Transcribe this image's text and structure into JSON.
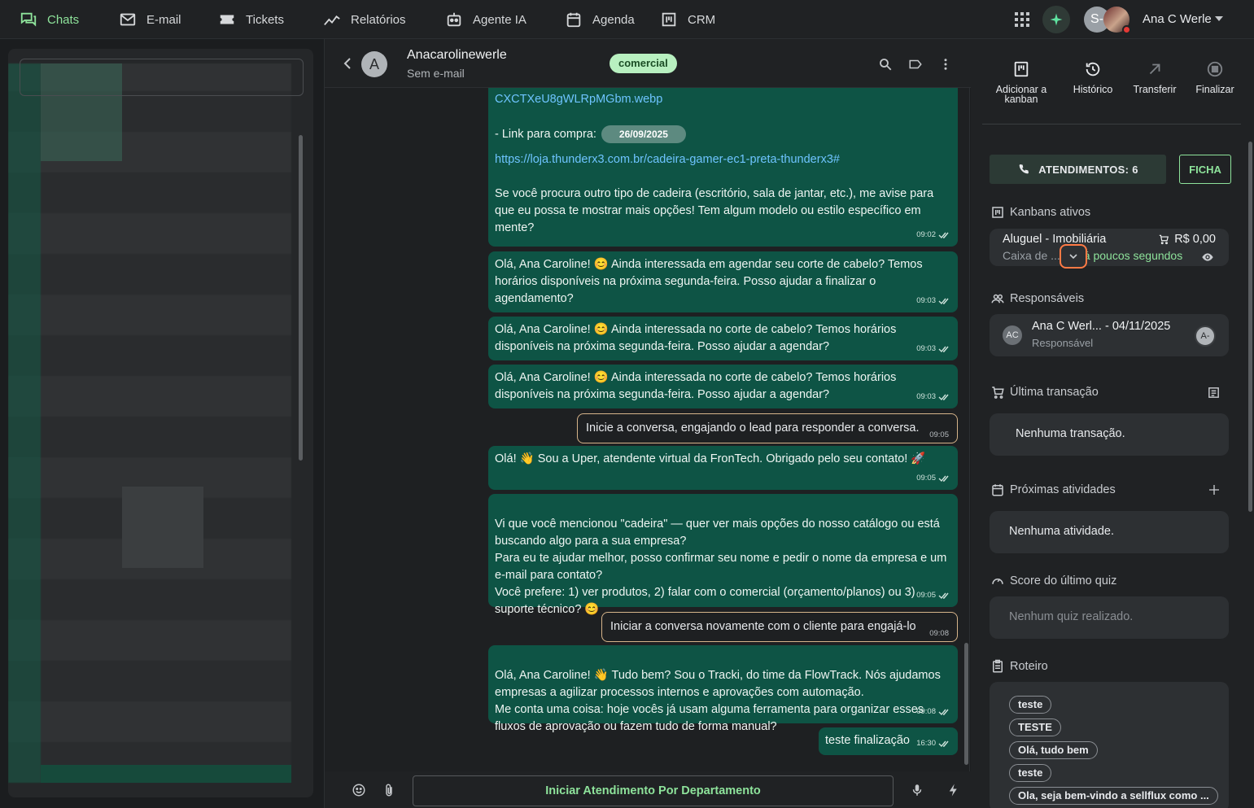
{
  "nav": {
    "items": [
      {
        "label": "Chats",
        "icon": "chat-icon",
        "active": true
      },
      {
        "label": "E-mail",
        "icon": "mail-icon"
      },
      {
        "label": "Tickets",
        "icon": "ticket-icon"
      },
      {
        "label": "Relatórios",
        "icon": "chart-line-icon"
      },
      {
        "label": "Agente IA",
        "icon": "robot-icon"
      },
      {
        "label": "Agenda",
        "icon": "calendar-icon"
      },
      {
        "label": "CRM",
        "icon": "kanban-icon"
      }
    ],
    "user_initial": "S-",
    "user_name": "Ana C Werle"
  },
  "chat": {
    "contact_initial": "A",
    "contact_name": "Anacarolinewerle",
    "contact_sub": "Sem e-mail",
    "tag": "comercial",
    "messages": [
      {
        "link1": "CXCTXeU8gWLRpMGbm.webp",
        "buy_label": "- Link para compra:",
        "date_chip": "26/09/2025",
        "link2": "https://loja.thunderx3.com.br/cadeira-gamer-ec1-preta-thunderx3#",
        "text": "Se você procura outro tipo de cadeira (escritório, sala de jantar, etc.), me avise para que eu possa te mostrar mais opções! Tem algum modelo ou estilo específico em mente?",
        "time": "09:02"
      },
      {
        "text": "Olá, Ana Caroline! 😊 Ainda interessada em agendar seu corte de cabelo? Temos horários disponíveis na próxima segunda-feira. Posso ajudar a finalizar o agendamento?",
        "time": "09:03"
      },
      {
        "text": "Olá, Ana Caroline! 😊 Ainda interessada no corte de cabelo? Temos horários disponíveis na próxima segunda-feira. Posso ajudar a agendar?",
        "time": "09:03"
      },
      {
        "text": "Olá, Ana Caroline! 😊 Ainda interessada no corte de cabelo? Temos horários disponíveis na próxima segunda-feira. Posso ajudar a agendar?",
        "time": "09:03"
      },
      {
        "text": "Inicie a conversa, engajando o lead para responder a conversa.",
        "time": "09:05"
      },
      {
        "text": "Olá! 👋 Sou a Uper, atendente virtual da FronTech. Obrigado pelo seu contato! 🚀",
        "time": "09:05"
      },
      {
        "text": "Vi que você mencionou \"cadeira\" — quer ver mais opções do nosso catálogo ou está buscando algo para a sua empresa?\nPara eu te ajudar melhor, posso confirmar seu nome e pedir o nome da empresa e um e-mail para contato?\nVocê prefere: 1) ver produtos, 2) falar com o comercial (orçamento/planos) ou 3) suporte técnico? 😊",
        "time": "09:05"
      },
      {
        "text": "Iniciar a conversa novamente com o cliente para engajá-lo",
        "time": "09:08"
      },
      {
        "text": "Olá, Ana Caroline! 👋 Tudo bem? Sou o Tracki, do time da FlowTrack. Nós ajudamos empresas a agilizar processos internos e aprovações com automação.\nMe conta uma coisa: hoje vocês já usam alguma ferramenta para organizar esses fluxos de aprovação ou fazem tudo de forma manual?",
        "time": "09:08"
      },
      {
        "text": "teste finalização",
        "time": "16:30"
      }
    ],
    "start_button": "Iniciar Atendimento Por Departamento"
  },
  "panel": {
    "actions": [
      {
        "label": "Adicionar a kanban",
        "icon": "kanban-add-icon"
      },
      {
        "label": "Histórico",
        "icon": "history-icon"
      },
      {
        "label": "Transferir",
        "icon": "transfer-icon"
      },
      {
        "label": "Finalizar",
        "icon": "stop-icon"
      }
    ],
    "atendimentos": "ATENDIMENTOS: 6",
    "ficha": "FICHA",
    "kanbans_title": "Kanbans ativos",
    "kanban": {
      "title": "Aluguel - Imobiliária",
      "price": "R$ 0,00",
      "sub": "Caixa de ...",
      "when": "há poucos segundos"
    },
    "responsaveis_title": "Responsáveis",
    "responsavel": {
      "initials": "AC",
      "name": "Ana C Werl... - 04/11/2025",
      "role": "Responsável",
      "badge": "A-"
    },
    "transacao_title": "Última transação",
    "transacao_empty": "Nenhuma transação.",
    "atividades_title": "Próximas atividades",
    "atividades_empty": "Nenhuma atividade.",
    "quiz_title": "Score do último quiz",
    "quiz_empty": "Nenhum quiz realizado.",
    "roteiro_title": "Roteiro",
    "roteiro_chips": [
      "teste",
      "TESTE",
      "Olá, tudo bem",
      "teste",
      "Ola, seja bem-vindo a sellflux como ..."
    ]
  },
  "colors": {
    "accent": "#8ee39b",
    "bubble": "#0e5445",
    "note_border": "#d6b48a",
    "highlight": "#ff7a45"
  }
}
